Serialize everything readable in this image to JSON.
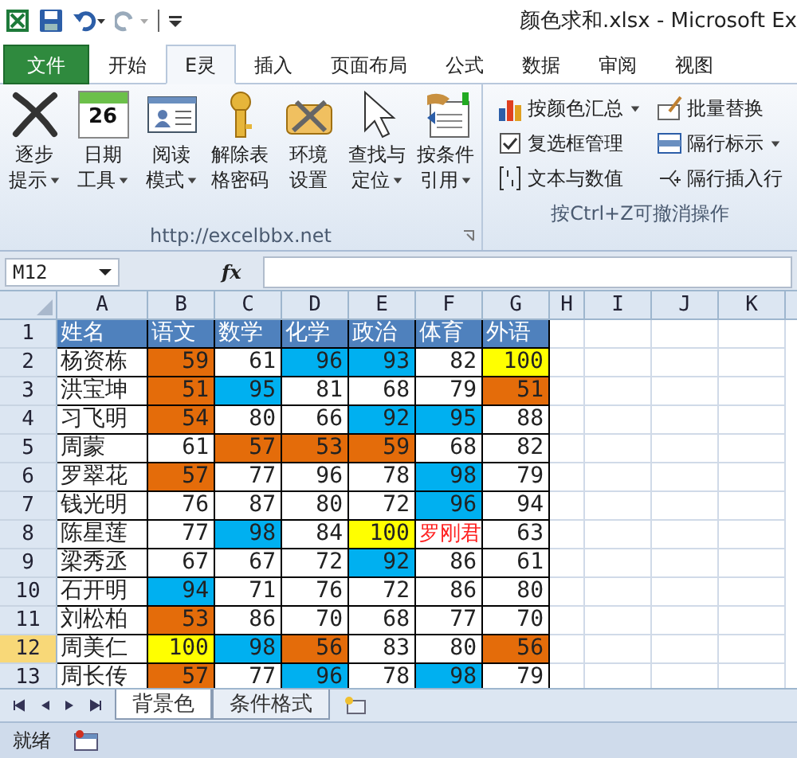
{
  "window": {
    "title": "颜色求和.xlsx  -  Microsoft Ex"
  },
  "tabs": [
    {
      "label": "文件",
      "kind": "file",
      "selected": false
    },
    {
      "label": "开始",
      "kind": "tab",
      "selected": false
    },
    {
      "label": "E灵",
      "kind": "tab",
      "selected": true
    },
    {
      "label": "插入",
      "kind": "tab",
      "selected": false
    },
    {
      "label": "页面布局",
      "kind": "tab",
      "selected": false
    },
    {
      "label": "公式",
      "kind": "tab",
      "selected": false
    },
    {
      "label": "数据",
      "kind": "tab",
      "selected": false
    },
    {
      "label": "审阅",
      "kind": "tab",
      "selected": false
    },
    {
      "label": "视图",
      "kind": "tab",
      "selected": false
    }
  ],
  "ribbon": {
    "groups": [
      {
        "label": "http://excelbbx.net",
        "kind": "large",
        "buttons": [
          {
            "lines": [
              "逐步",
              "提示"
            ],
            "dropdown": true
          },
          {
            "icon_text": "26",
            "lines": [
              "日期",
              "工具"
            ],
            "dropdown": true
          },
          {
            "lines": [
              "阅读",
              "模式"
            ],
            "dropdown": true
          },
          {
            "lines": [
              "解除表",
              "格密码"
            ],
            "dropdown": false
          },
          {
            "lines": [
              "环境",
              "设置"
            ],
            "dropdown": false
          },
          {
            "lines": [
              "查找与",
              "定位"
            ],
            "dropdown": true
          },
          {
            "lines": [
              "按条件",
              "引用"
            ],
            "dropdown": true
          }
        ]
      },
      {
        "label": "按Ctrl+Z可撤消操作",
        "kind": "small",
        "buttons": [
          {
            "label": "按颜色汇总",
            "dropdown": true
          },
          {
            "label": "批量替换",
            "dropdown": false
          },
          {
            "label": "复选框管理",
            "dropdown": false
          },
          {
            "label": "隔行标示",
            "dropdown": true
          },
          {
            "label": "文本与数值",
            "dropdown": false
          },
          {
            "label": "隔行插入行",
            "dropdown": false
          }
        ]
      }
    ]
  },
  "formula_bar": {
    "name_box": "M12",
    "fx": "fx"
  },
  "sheet": {
    "columns": [
      "A",
      "B",
      "C",
      "D",
      "E",
      "F",
      "G",
      "H",
      "I",
      "J",
      "K"
    ],
    "rows": [
      {
        "number": "1",
        "selected": false,
        "cells": [
          {
            "text": "姓名",
            "kind": "header"
          },
          {
            "text": "语文",
            "kind": "header"
          },
          {
            "text": "数学",
            "kind": "header"
          },
          {
            "text": "化学",
            "kind": "header"
          },
          {
            "text": "政治",
            "kind": "header"
          },
          {
            "text": "体育",
            "kind": "header"
          },
          {
            "text": "外语",
            "kind": "header"
          }
        ]
      },
      {
        "number": "2",
        "selected": false,
        "cells": [
          {
            "text": "杨资栋",
            "kind": "name"
          },
          {
            "text": "59",
            "color": "#e46c0a"
          },
          {
            "text": "61"
          },
          {
            "text": "96",
            "color": "#00b0f0"
          },
          {
            "text": "93",
            "color": "#00b0f0"
          },
          {
            "text": "82"
          },
          {
            "text": "100",
            "color": "#ffff00"
          }
        ]
      },
      {
        "number": "3",
        "selected": false,
        "cells": [
          {
            "text": "洪宝坤",
            "kind": "name"
          },
          {
            "text": "51",
            "color": "#e46c0a"
          },
          {
            "text": "95",
            "color": "#00b0f0"
          },
          {
            "text": "81"
          },
          {
            "text": "68"
          },
          {
            "text": "79"
          },
          {
            "text": "51",
            "color": "#e46c0a"
          }
        ]
      },
      {
        "number": "4",
        "selected": false,
        "cells": [
          {
            "text": "习飞明",
            "kind": "name"
          },
          {
            "text": "54",
            "color": "#e46c0a"
          },
          {
            "text": "80"
          },
          {
            "text": "66"
          },
          {
            "text": "92",
            "color": "#00b0f0"
          },
          {
            "text": "95",
            "color": "#00b0f0"
          },
          {
            "text": "88"
          }
        ]
      },
      {
        "number": "5",
        "selected": false,
        "cells": [
          {
            "text": "周蒙",
            "kind": "name"
          },
          {
            "text": "61"
          },
          {
            "text": "57",
            "color": "#e46c0a"
          },
          {
            "text": "53",
            "color": "#e46c0a"
          },
          {
            "text": "59",
            "color": "#e46c0a"
          },
          {
            "text": "68"
          },
          {
            "text": "82"
          }
        ]
      },
      {
        "number": "6",
        "selected": false,
        "cells": [
          {
            "text": "罗翠花",
            "kind": "name"
          },
          {
            "text": "57",
            "color": "#e46c0a"
          },
          {
            "text": "77"
          },
          {
            "text": "96"
          },
          {
            "text": "78"
          },
          {
            "text": "98",
            "color": "#00b0f0"
          },
          {
            "text": "79"
          }
        ]
      },
      {
        "number": "7",
        "selected": false,
        "cells": [
          {
            "text": "钱光明",
            "kind": "name"
          },
          {
            "text": "76"
          },
          {
            "text": "87"
          },
          {
            "text": "80"
          },
          {
            "text": "72"
          },
          {
            "text": "96",
            "color": "#00b0f0"
          },
          {
            "text": "94"
          }
        ]
      },
      {
        "number": "8",
        "selected": false,
        "cells": [
          {
            "text": "陈星莲",
            "kind": "name"
          },
          {
            "text": "77"
          },
          {
            "text": "98",
            "color": "#00b0f0"
          },
          {
            "text": "84"
          },
          {
            "text": "100",
            "color": "#ffff00"
          },
          {
            "text": "罗刚君",
            "kind": "red_text"
          },
          {
            "text": "63"
          }
        ]
      },
      {
        "number": "9",
        "selected": false,
        "cells": [
          {
            "text": "梁秀丞",
            "kind": "name"
          },
          {
            "text": "67"
          },
          {
            "text": "67"
          },
          {
            "text": "72"
          },
          {
            "text": "92",
            "color": "#00b0f0"
          },
          {
            "text": "86"
          },
          {
            "text": "61"
          }
        ]
      },
      {
        "number": "10",
        "selected": false,
        "cells": [
          {
            "text": "石开明",
            "kind": "name"
          },
          {
            "text": "94",
            "color": "#00b0f0"
          },
          {
            "text": "71"
          },
          {
            "text": "76"
          },
          {
            "text": "72"
          },
          {
            "text": "86"
          },
          {
            "text": "80"
          }
        ]
      },
      {
        "number": "11",
        "selected": false,
        "cells": [
          {
            "text": "刘松柏",
            "kind": "name"
          },
          {
            "text": "53",
            "color": "#e46c0a"
          },
          {
            "text": "86"
          },
          {
            "text": "70"
          },
          {
            "text": "68"
          },
          {
            "text": "77"
          },
          {
            "text": "70"
          }
        ]
      },
      {
        "number": "12",
        "selected": true,
        "cells": [
          {
            "text": "周美仁",
            "kind": "name"
          },
          {
            "text": "100",
            "color": "#ffff00"
          },
          {
            "text": "98",
            "color": "#00b0f0"
          },
          {
            "text": "56",
            "color": "#e46c0a"
          },
          {
            "text": "83"
          },
          {
            "text": "80"
          },
          {
            "text": "56",
            "color": "#e46c0a"
          }
        ]
      },
      {
        "number": "13",
        "selected": false,
        "cells": [
          {
            "text": "周长传",
            "kind": "name"
          },
          {
            "text": "57",
            "color": "#e46c0a"
          },
          {
            "text": "77"
          },
          {
            "text": "96",
            "color": "#00b0f0"
          },
          {
            "text": "78"
          },
          {
            "text": "98",
            "color": "#00b0f0"
          },
          {
            "text": "79"
          }
        ]
      }
    ]
  },
  "sheet_tabs": [
    {
      "label": "背景色",
      "selected": true
    },
    {
      "label": "条件格式",
      "selected": false
    }
  ],
  "status_bar": {
    "text": "就绪"
  }
}
